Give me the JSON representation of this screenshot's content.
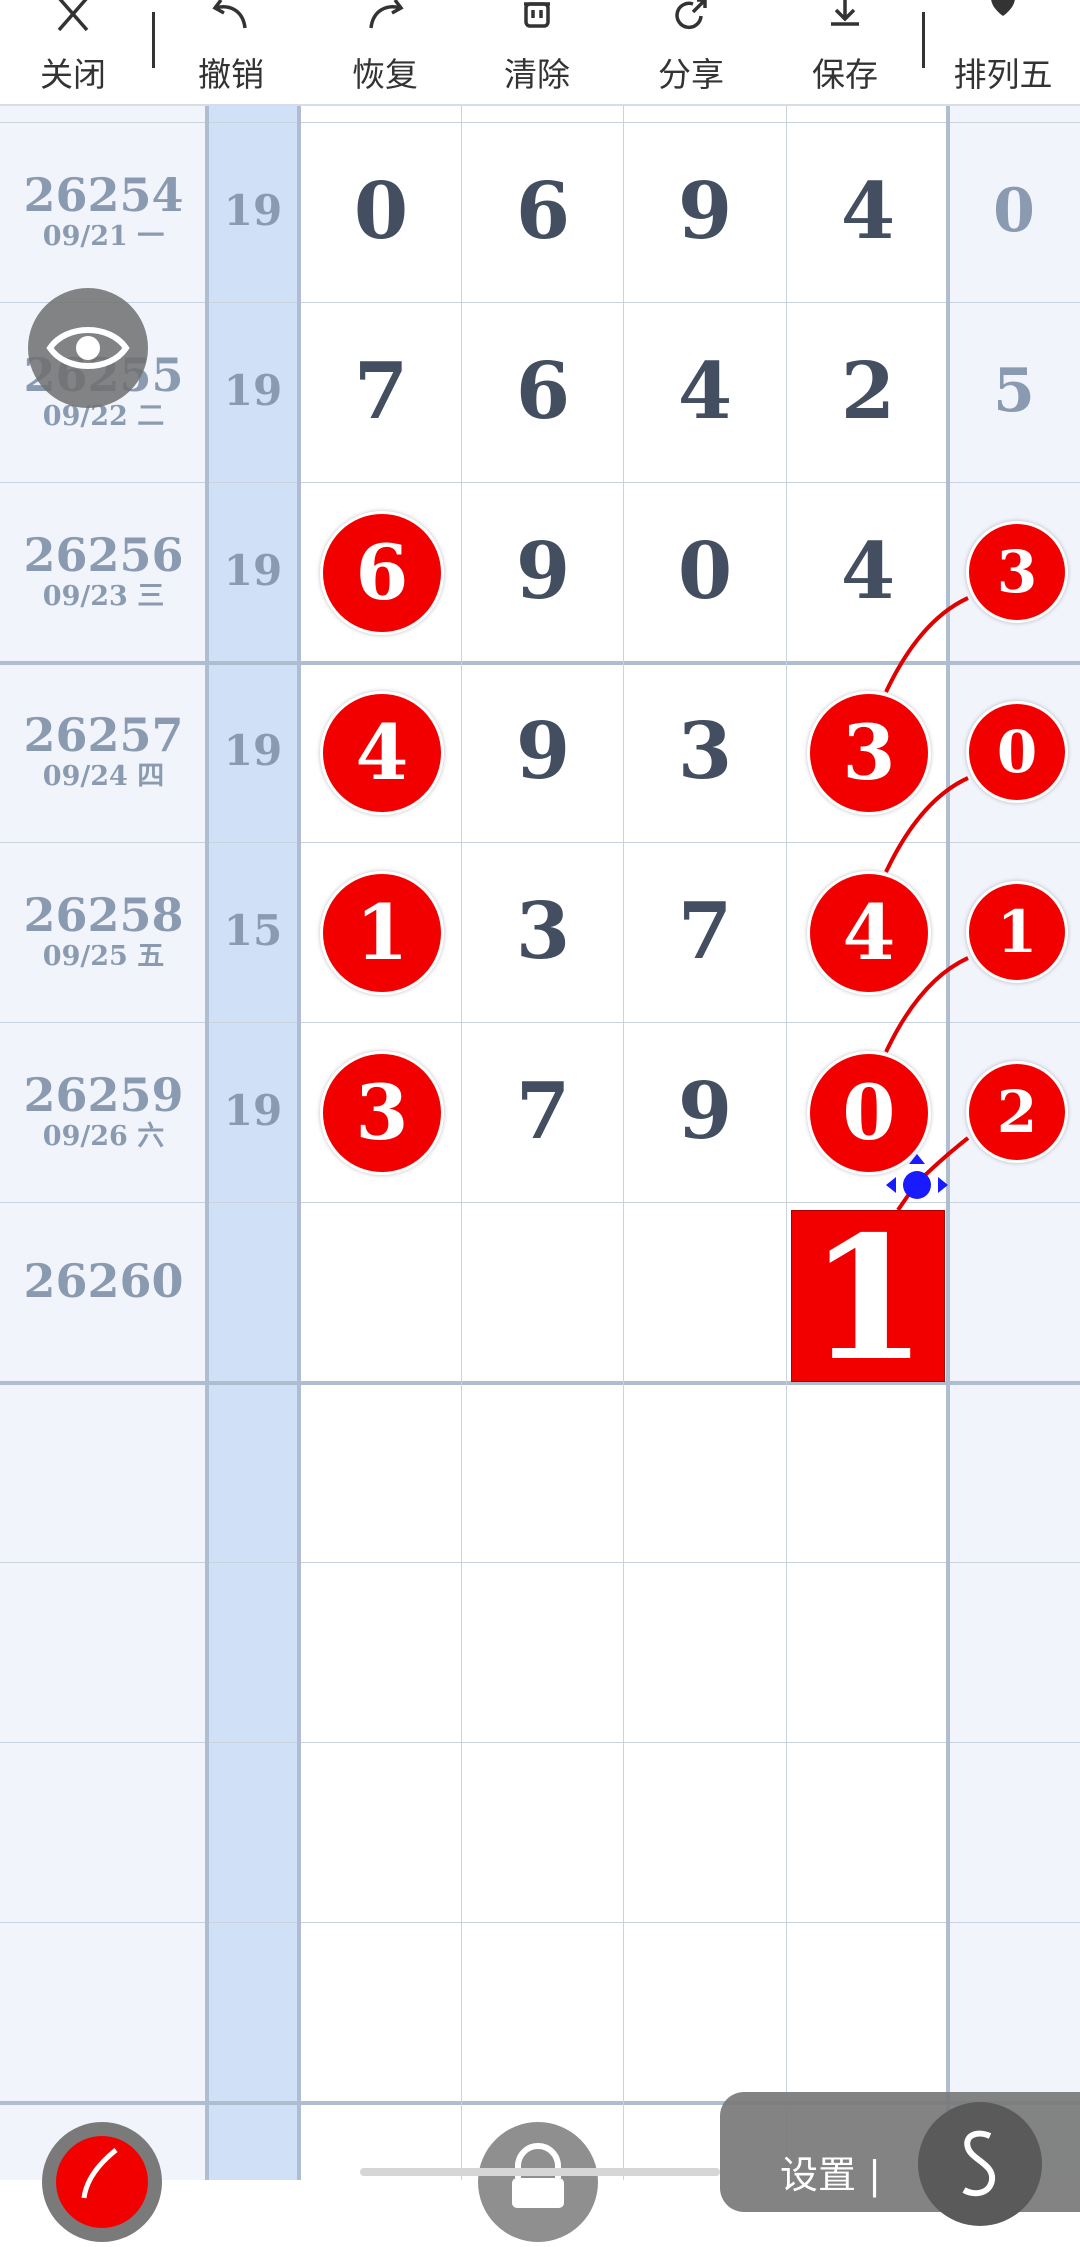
{
  "toolbar": {
    "close_label": "关闭",
    "undo_label": "撤销",
    "redo_label": "恢复",
    "clear_label": "清除",
    "share_label": "分享",
    "save_label": "保存",
    "mode_label": "排列五"
  },
  "rows": [
    {
      "issue": "26254",
      "date": "09/21 一",
      "sum": "19",
      "digits": [
        "0",
        "6",
        "9",
        "4"
      ],
      "last": "0"
    },
    {
      "issue": "26255",
      "date": "09/22 二",
      "sum": "19",
      "digits": [
        "7",
        "6",
        "4",
        "2"
      ],
      "last": "5"
    },
    {
      "issue": "26256",
      "date": "09/23 三",
      "sum": "19",
      "digits": [
        "6",
        "9",
        "0",
        "4"
      ],
      "last": "3"
    },
    {
      "issue": "26257",
      "date": "09/24 四",
      "sum": "19",
      "digits": [
        "4",
        "9",
        "3",
        "3"
      ],
      "last": "0"
    },
    {
      "issue": "26258",
      "date": "09/25 五",
      "sum": "15",
      "digits": [
        "1",
        "3",
        "7",
        "4"
      ],
      "last": "1"
    },
    {
      "issue": "26259",
      "date": "09/26 六",
      "sum": "19",
      "digits": [
        "3",
        "7",
        "9",
        "0"
      ],
      "last": "2"
    },
    {
      "issue": "26260",
      "date": "",
      "sum": "",
      "digits": [
        "",
        "",
        "",
        ""
      ],
      "last": ""
    }
  ],
  "prediction": {
    "value": "1"
  },
  "settings": {
    "label": "设置 |"
  },
  "colors": {
    "ball": "#f20000",
    "sum_column": "#cfe0f7",
    "handle": "#1a1aff"
  },
  "icons": {
    "eye": "eye-icon",
    "pen": "pen-icon",
    "lock": "lock-icon",
    "script": "script-s-icon"
  }
}
